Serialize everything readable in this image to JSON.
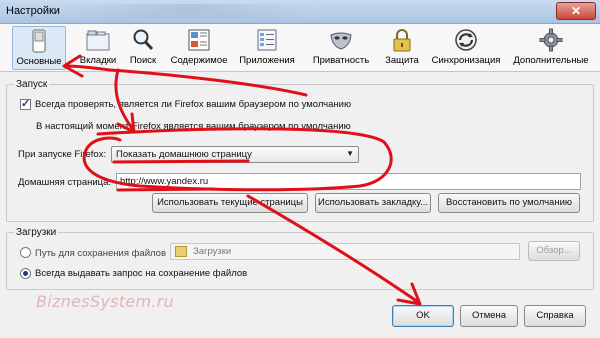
{
  "window": {
    "title": "Настройки",
    "close_glyph": "✕"
  },
  "toolbar": {
    "items": [
      {
        "label": "Основные",
        "icon": "switch-icon",
        "selected": true
      },
      {
        "label": "Вкладки",
        "icon": "tabs-icon"
      },
      {
        "label": "Поиск",
        "icon": "magnifier-icon"
      },
      {
        "label": "Содержимое",
        "icon": "content-icon"
      },
      {
        "label": "Приложения",
        "icon": "applications-icon"
      },
      {
        "label": "Приватность",
        "icon": "privacy-mask-icon"
      },
      {
        "label": "Защита",
        "icon": "lock-icon"
      },
      {
        "label": "Синхронизация",
        "icon": "sync-icon"
      },
      {
        "label": "Дополнительные",
        "icon": "gear-icon"
      }
    ]
  },
  "startup": {
    "group_label": "Запуск",
    "default_check_label": "Всегда проверять, является ли Firefox вашим браузером по умолчанию",
    "default_check_checked": true,
    "default_status": "В настоящий момент Firefox является вашим браузером по умолчанию",
    "on_start_label": "При запуске Firefox:",
    "on_start_value": "Показать домашнюю страницу",
    "homepage_label": "Домашняя страница:",
    "homepage_value": "http://www.yandex.ru",
    "btn_current": "Использовать текущие страницы",
    "btn_bookmark": "Использовать закладку...",
    "btn_restore": "Восстановить по умолчанию"
  },
  "downloads": {
    "group_label": "Загрузки",
    "save_path_label": "Путь для сохранения файлов",
    "save_path_value": "Загрузки",
    "browse_label": "Обзор...",
    "always_ask_label": "Всегда выдавать запрос на сохранение файлов",
    "always_ask_selected": true
  },
  "footer": {
    "ok": "OK",
    "cancel": "Отмена",
    "help": "Справка"
  },
  "watermark": "BiznesSystem.ru",
  "colors": {
    "annotation": "#e0101a",
    "selected_tab": "#dbe8f6",
    "titlebar": "#b9d1ec"
  }
}
